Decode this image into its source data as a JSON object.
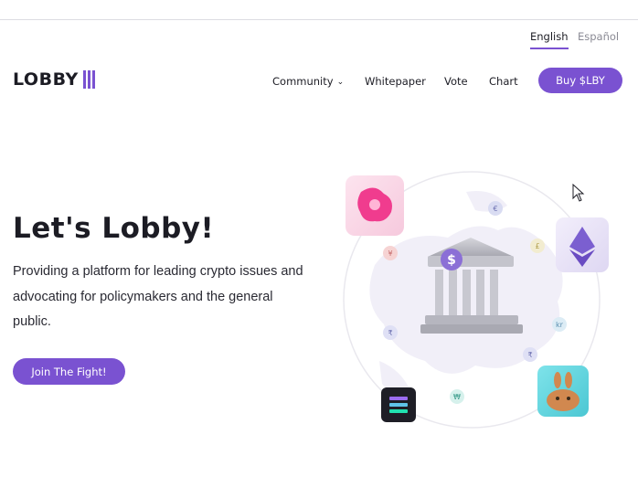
{
  "languages": {
    "english": "English",
    "spanish": "Español"
  },
  "logo": {
    "text": "LOBBY"
  },
  "nav": {
    "community": "Community",
    "whitepaper": "Whitepaper",
    "vote": "Vote",
    "chart": "Chart",
    "buy": "Buy $LBY"
  },
  "hero": {
    "title": "Let's Lobby!",
    "subtitle": "Providing a platform for leading crypto issues and advocating for policymakers and the general public.",
    "cta": "Join The Fight!"
  },
  "illustration": {
    "coin_symbols": [
      "$",
      "€",
      "¥",
      "£",
      "₹",
      "kr",
      "₩",
      "₹"
    ],
    "icons": [
      "uniswap-icon",
      "ethereum-icon",
      "solana-icon",
      "pancakeswap-icon",
      "bank-building-icon"
    ]
  },
  "colors": {
    "accent": "#7a52d1",
    "text": "#1c1c24",
    "muted": "#8a8a94"
  }
}
